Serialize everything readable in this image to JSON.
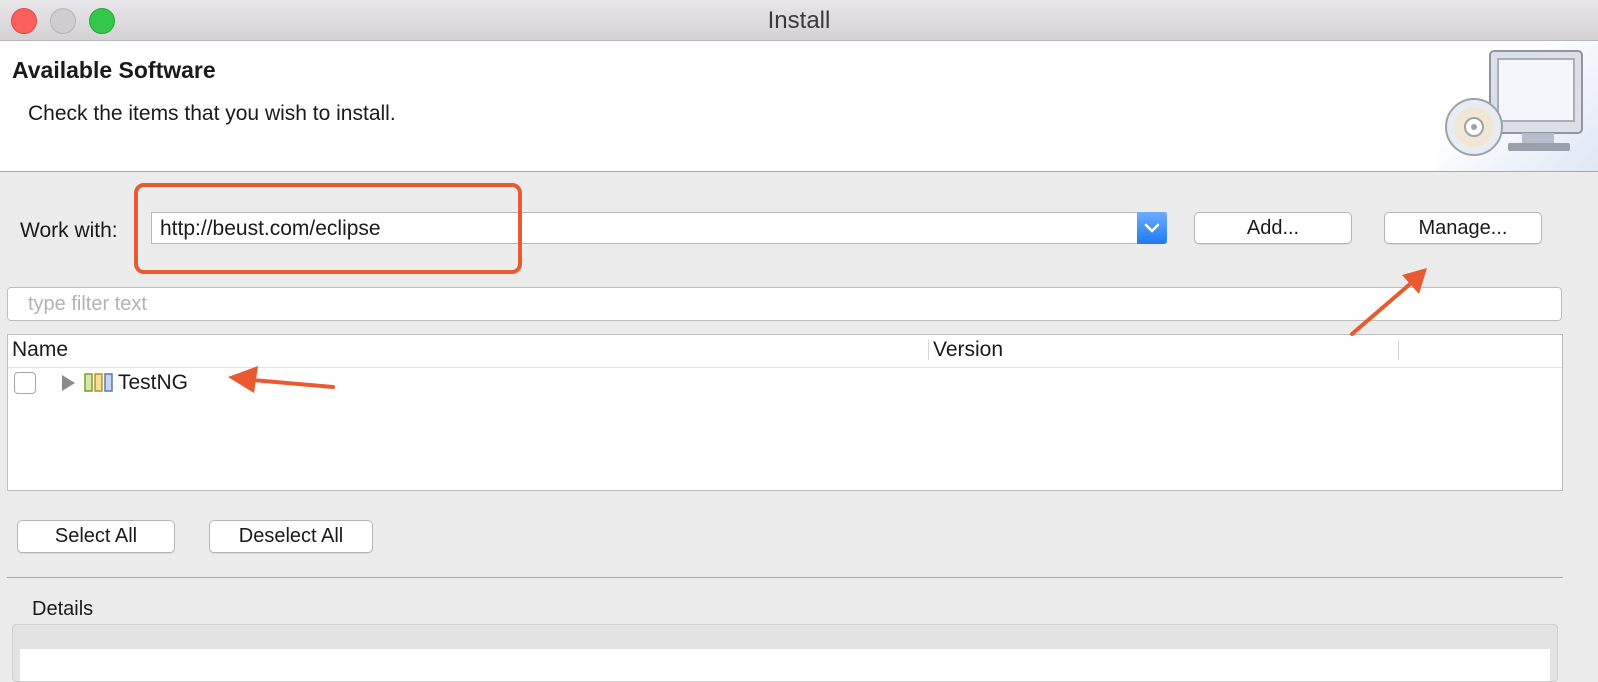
{
  "window": {
    "title": "Install"
  },
  "header": {
    "title": "Available Software",
    "description": "Check the items that you wish to install."
  },
  "work_with": {
    "label": "Work with:",
    "value": "http://beust.com/eclipse",
    "add_label": "Add...",
    "manage_label": "Manage..."
  },
  "filter": {
    "placeholder": "type filter text"
  },
  "table": {
    "columns": [
      "Name",
      "Version"
    ],
    "rows": [
      {
        "name": "TestNG",
        "checked": false,
        "expanded": false
      }
    ]
  },
  "buttons": {
    "select_all": "Select All",
    "deselect_all": "Deselect All"
  },
  "details": {
    "label": "Details"
  },
  "annotations": {
    "color": "#ea5a30"
  }
}
